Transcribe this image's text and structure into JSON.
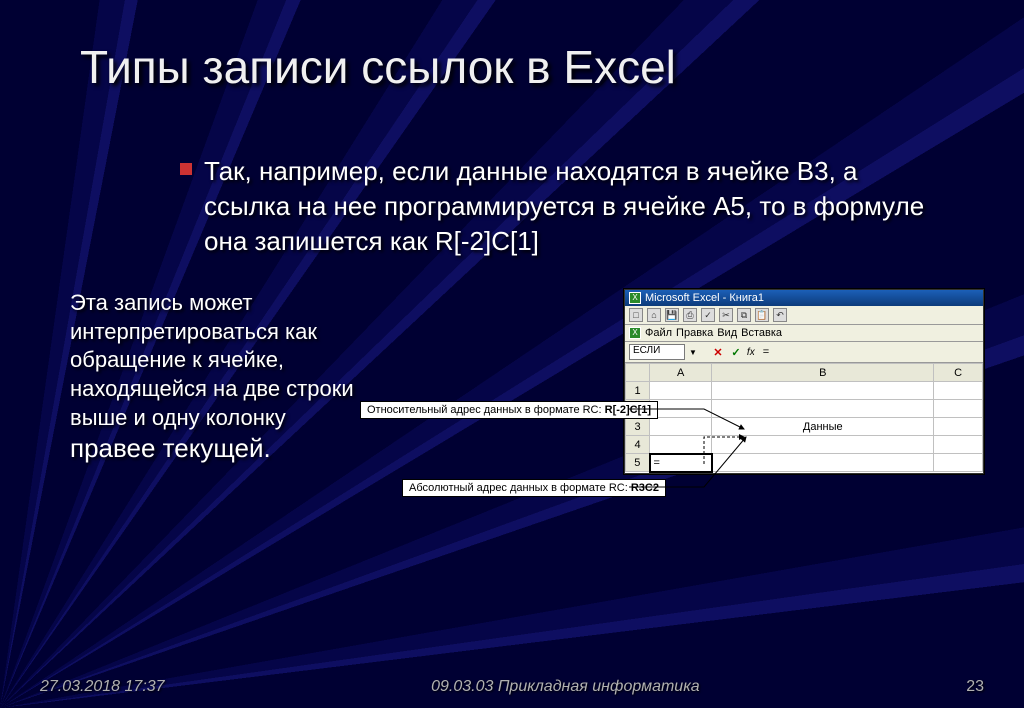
{
  "title": "Типы записи ссылок в Excel",
  "body": "Так, например, если данные находятся в ячейке В3, а ссылка на нее программируется в ячейке А5, то в формуле она запишется как R[-2]C[1]",
  "note_part1": "Эта запись может интерпретироваться как обращение к ячейке, находящейся на две строки выше и одну колонку",
  "note_part2": "правее текущей.",
  "excel": {
    "title": "Microsoft Excel - Книга1",
    "menu": {
      "file": "Файл",
      "edit": "Правка",
      "view": "Вид",
      "insert": "Вставка"
    },
    "namebox": "ЕСЛИ",
    "fx_label": "fx",
    "fx_value": "=",
    "cols": [
      "A",
      "B",
      "C"
    ],
    "rows": [
      "1",
      "2",
      "3",
      "4",
      "5"
    ],
    "b3": "Данные",
    "a5": "="
  },
  "callout1_prefix": "Относительный адрес данных в формате RC: ",
  "callout1_value": "R[-2]C[1]",
  "callout2_prefix": "Абсолютный адрес данных в формате RC: ",
  "callout2_value": "R3C2",
  "footer": {
    "date": "27.03.2018 17:37",
    "mid": "09.03.03 Прикладная информатика",
    "page": "23"
  }
}
